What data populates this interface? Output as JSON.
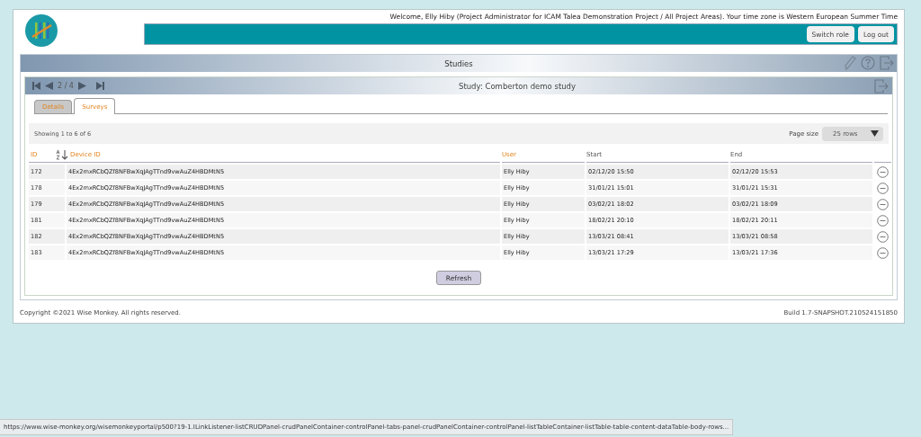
{
  "header": {
    "welcome": "Welcome, Elly Hiby (Project Administrator for ICAM Talea Demonstration Project / All Project Areas). Your time zone is Western European Summer Time",
    "buttons": [
      "Switch role",
      "Log out"
    ]
  },
  "studies_panel": {
    "title": "Studies"
  },
  "study": {
    "pager": "2 / 4",
    "title": "Study: Comberton demo study"
  },
  "tabs": [
    {
      "label": "Details",
      "selected": false
    },
    {
      "label": "Surveys",
      "selected": true
    }
  ],
  "table": {
    "showing": "Showing 1 to 6 of 6",
    "page_size_label": "Page size",
    "page_size": "25 rows",
    "columns": [
      {
        "label": "ID",
        "sortable": true,
        "sorted": false
      },
      {
        "label": "Device ID",
        "sortable": true,
        "sorted": true
      },
      {
        "label": "User",
        "sortable": true,
        "sorted": false
      },
      {
        "label": "Start",
        "sortable": false,
        "sorted": false
      },
      {
        "label": "End",
        "sortable": false,
        "sorted": false
      }
    ],
    "rows": [
      [
        "172",
        "4Ex2mxRCbQZf8NFBwXqJAgTTnd9vwAuZ4HBDMtN5",
        "Elly Hiby",
        "02/12/20 15:50",
        "02/12/20 15:53"
      ],
      [
        "178",
        "4Ex2mxRCbQZf8NFBwXqJAgTTnd9vwAuZ4HBDMtN5",
        "Elly Hiby",
        "31/01/21 15:01",
        "31/01/21 15:31"
      ],
      [
        "179",
        "4Ex2mxRCbQZf8NFBwXqJAgTTnd9vwAuZ4HBDMtN5",
        "Elly Hiby",
        "03/02/21 18:02",
        "03/02/21 18:09"
      ],
      [
        "181",
        "4Ex2mxRCbQZf8NFBwXqJAgTTnd9vwAuZ4HBDMtN5",
        "Elly Hiby",
        "18/02/21 20:10",
        "18/02/21 20:11"
      ],
      [
        "182",
        "4Ex2mxRCbQZf8NFBwXqJAgTTnd9vwAuZ4HBDMtN5",
        "Elly Hiby",
        "13/03/21 08:41",
        "13/03/21 08:58"
      ],
      [
        "183",
        "4Ex2mxRCbQZf8NFBwXqJAgTTnd9vwAuZ4HBDMtN5",
        "Elly Hiby",
        "13/03/21 17:29",
        "13/03/21 17:36"
      ]
    ],
    "refresh": "Refresh"
  },
  "footer": {
    "copyright": "Copyright ©2021 Wise Monkey. All rights reserved.",
    "build": "Build 1.7-SNAPSHOT.210524151850"
  },
  "status_bar": "https://www.wise-monkey.org/wisemonkeyportal/p500?19-1.ILinkListener-listCRUDPanel-crudPanelContainer-controlPanel-tabs-panel-crudPanelContainer-controlPanel-listTableContainer-listTable-table-content-dataTable-body-rows..."
}
